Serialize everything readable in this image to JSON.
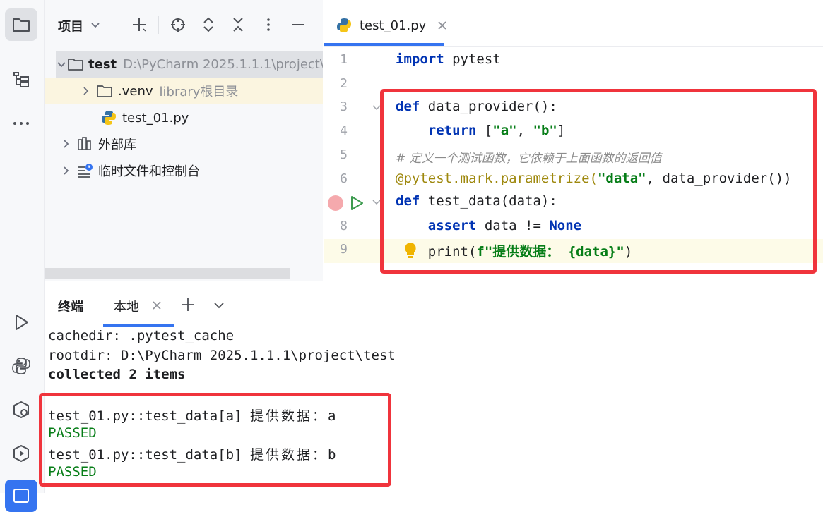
{
  "project": {
    "title": "项目",
    "tree": [
      {
        "name": "test",
        "path": "D:\\PyCharm 2025.1.1.1\\project\\"
      },
      {
        "name": ".venv",
        "note": "library根目录"
      },
      {
        "name": "test_01.py"
      },
      {
        "name": "外部库"
      },
      {
        "name": "临时文件和控制台"
      }
    ]
  },
  "editor": {
    "tab": {
      "label": "test_01.py"
    },
    "lines": [
      {
        "n": "1"
      },
      {
        "n": "2"
      },
      {
        "n": "3"
      },
      {
        "n": "4"
      },
      {
        "n": "5"
      },
      {
        "n": "6"
      },
      {
        "n": "7"
      },
      {
        "n": "8"
      },
      {
        "n": "9"
      }
    ],
    "tokens": {
      "import": "import",
      "pytest": " pytest",
      "def": "def",
      "data_provider": " data_provider():",
      "return": "    return",
      "list_open": " [",
      "a": "\"a\"",
      "comma": ", ",
      "b": "\"b\"",
      "list_close": "]",
      "comment": "# 定义一个测试函数，它依赖于上面函数的返回值",
      "decorator": "@pytest.mark.parametrize(",
      "data_str": "\"data\"",
      "dec_rest": ", data_provider())",
      "test_data": " test_data(data):",
      "assert": "    assert",
      "assert_rest": " data != ",
      "none": "None",
      "print": "    print(",
      "fstr_prefix": "f\"",
      "fstr_cn": "提供数据：",
      "fstr_var": " {data}",
      "fstr_end": "\"",
      "print_close": ")"
    }
  },
  "terminal": {
    "title": "终端",
    "tab": "本地",
    "lines": [
      "cachedir: .pytest_cache",
      "rootdir: D:\\PyCharm 2025.1.1.1\\project\\test",
      "collected 2 items",
      "test_01.py::test_data[a]",
      "提供数据：",
      "a",
      "PASSED",
      "test_01.py::test_data[b]",
      "提供数据：",
      "b",
      "PASSED"
    ]
  },
  "colors": {
    "accent": "#3574f0",
    "highlight_box": "#f0343c",
    "keyword": "#0033b3",
    "string": "#067d17",
    "decorator": "#9e880d",
    "passed": "#067d17"
  },
  "icons": {
    "strip": [
      "folder-icon",
      "structure-icon",
      "more-icon",
      "run-icon",
      "python-console-icon",
      "services-icon",
      "play-services-icon",
      "terminal-icon"
    ],
    "project_toolbar": [
      "chevron-down-icon",
      "new-file-icon",
      "locate-icon",
      "expand-all-icon",
      "collapse-all-icon",
      "options-icon",
      "hide-icon"
    ]
  }
}
